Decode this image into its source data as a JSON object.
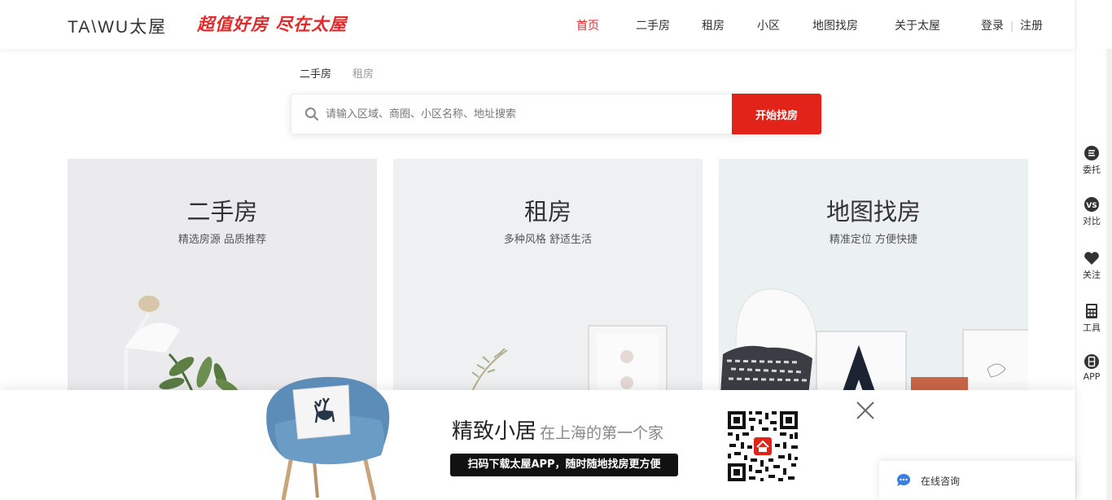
{
  "header": {
    "logo": "TA\\WU太屋",
    "slogan": "超值好房 尽在太屋",
    "nav": [
      "首页",
      "二手房",
      "租房",
      "小区",
      "地图找房",
      "关于太屋"
    ],
    "login": "登录",
    "separator": "|",
    "register": "注册"
  },
  "search": {
    "tabs": [
      "二手房",
      "租房"
    ],
    "placeholder": "请输入区域、商圈、小区名称、地址搜索",
    "button": "开始找房"
  },
  "cards": [
    {
      "title": "二手房",
      "subtitle": "精选房源 品质推荐"
    },
    {
      "title": "租房",
      "subtitle": "多种风格 舒适生活"
    },
    {
      "title": "地图找房",
      "subtitle": "精准定位 方便快捷"
    }
  ],
  "sidebar": [
    {
      "label": "委托",
      "icon": "entrust-icon"
    },
    {
      "label": "对比",
      "icon": "vs-compare-icon"
    },
    {
      "label": "关注",
      "icon": "heart-icon"
    },
    {
      "label": "工具",
      "icon": "calculator-icon"
    },
    {
      "label": "APP",
      "icon": "app-icon"
    }
  ],
  "banner": {
    "title": "精致小居",
    "title_small": "在上海的第一个家",
    "pill": "扫码下载太屋APP，随时随地找房更方便"
  },
  "consult": {
    "label": "在线咨询"
  },
  "colors": {
    "accent": "#e2231a",
    "nav_active": "#e32a2a",
    "text": "#333333"
  }
}
